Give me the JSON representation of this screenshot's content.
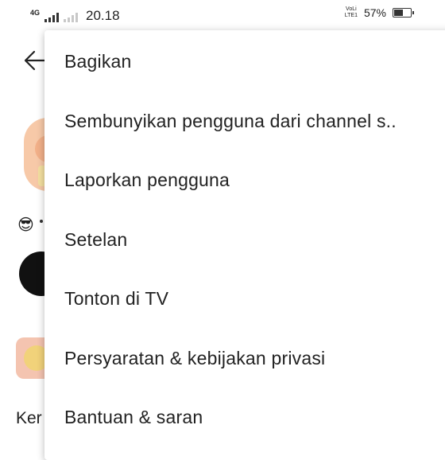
{
  "status_bar": {
    "network": "4G",
    "time": "20.18",
    "volte": [
      "VoLi",
      "LTE1"
    ],
    "battery_percent": "57%",
    "battery_level": 0.57
  },
  "background": {
    "partial_text": "Ker"
  },
  "menu": {
    "items": [
      "Bagikan",
      "Sembunyikan pengguna dari channel s..",
      "Laporkan pengguna",
      "Setelan",
      "Tonton di TV",
      "Persyaratan & kebijakan privasi",
      "Bantuan & saran"
    ]
  }
}
